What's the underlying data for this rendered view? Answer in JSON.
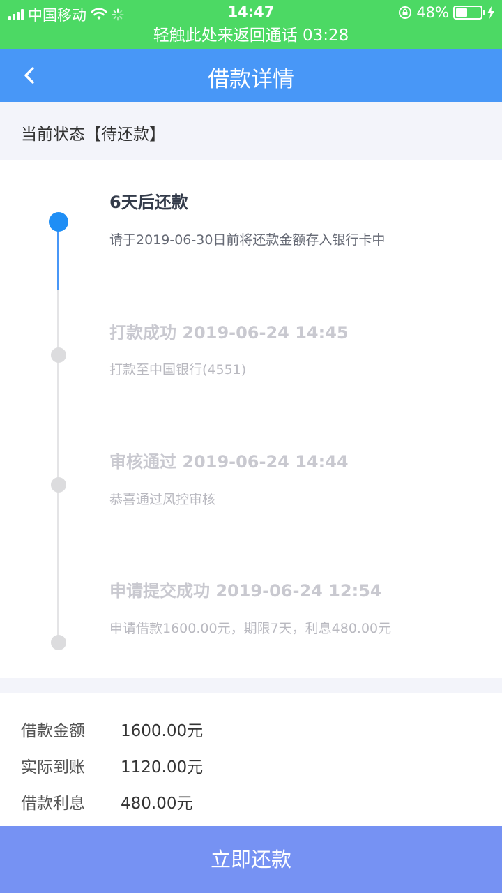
{
  "status_bar": {
    "carrier": "中国移动",
    "time": "14:47",
    "battery_percent": "48%",
    "battery_level": 0.48
  },
  "call_banner": {
    "text": "轻触此处来返回通话 03:28"
  },
  "nav": {
    "title": "借款详情",
    "back_icon": "chevron-left-icon"
  },
  "current_status": {
    "text": "当前状态【待还款】"
  },
  "timeline": [
    {
      "title": "6天后还款",
      "desc": "请于2019-06-30日前将还款金额存入银行卡中",
      "active": true
    },
    {
      "title": "打款成功 2019-06-24 14:45",
      "desc": "打款至中国银行(4551)",
      "active": false
    },
    {
      "title": "审核通过 2019-06-24 14:44",
      "desc": "恭喜通过风控审核",
      "active": false
    },
    {
      "title": "申请提交成功 2019-06-24 12:54",
      "desc": "申请借款1600.00元，期限7天，利息480.00元",
      "active": false
    }
  ],
  "loan_info": [
    {
      "label": "借款金额",
      "value": "1600.00元"
    },
    {
      "label": "实际到账",
      "value": "1120.00元"
    },
    {
      "label": "借款利息",
      "value": "480.00元"
    }
  ],
  "action": {
    "repay_label": "立即还款"
  },
  "colors": {
    "status_green": "#4cd964",
    "nav_blue": "#4897f7",
    "active_dot": "#1f8ef5",
    "button": "#7692f3"
  }
}
